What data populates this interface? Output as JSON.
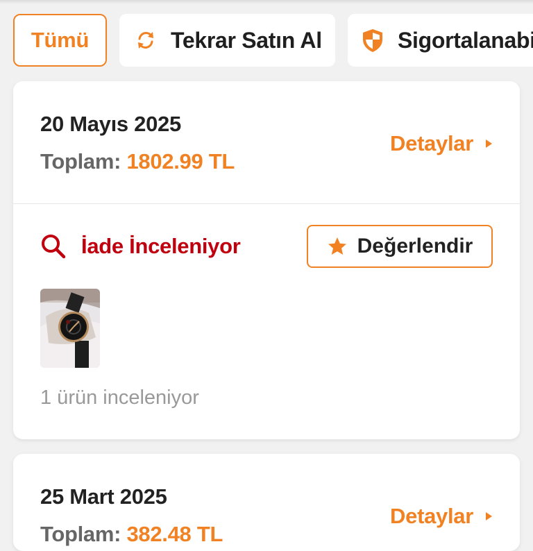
{
  "filters": {
    "all_label": "Tümü",
    "rebuy_label": "Tekrar Satın Al",
    "insurable_label": "Sigortalanabi",
    "rebuy_icon": "refresh-icon",
    "insurable_icon": "shield-icon"
  },
  "orders": [
    {
      "date": "20 Mayıs 2025",
      "total_label": "Toplam:",
      "total_amount": "1802.99 TL",
      "details_label": "Detaylar",
      "status": "İade İnceleniyor",
      "rate_label": "Değerlendir",
      "product_image": "black-wristwatch-photo",
      "item_count_text": "1 ürün inceleniyor"
    },
    {
      "date": "25 Mart 2025",
      "total_label": "Toplam:",
      "total_amount": "382.48 TL",
      "details_label": "Detaylar"
    }
  ],
  "colors": {
    "accent": "#f08223",
    "status_red": "#c0000e",
    "background": "#f1f1f1"
  }
}
